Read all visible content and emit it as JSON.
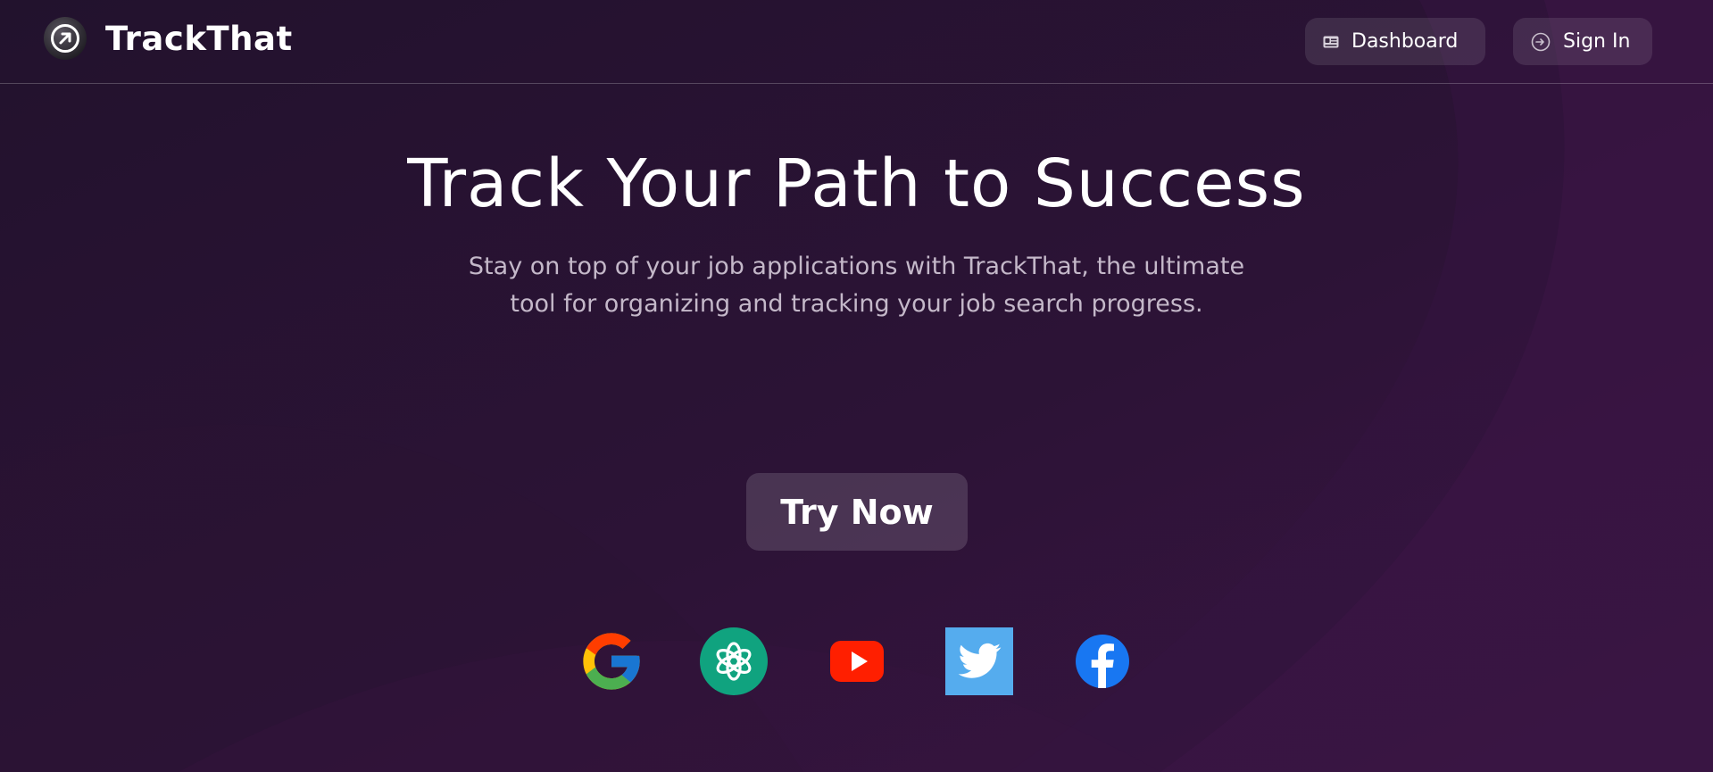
{
  "brand": {
    "name": "TrackThat",
    "logo_icon": "arrow-up-right-circle-icon"
  },
  "nav": {
    "dashboard_label": "Dashboard",
    "dashboard_icon": "id-card-icon",
    "signin_label": "Sign In",
    "signin_icon": "sign-in-icon"
  },
  "hero": {
    "title": "Track Your Path to Success",
    "subtitle": "Stay on top of your job applications with TrackThat, the ultimate tool for organizing and tracking your job search progress.",
    "cta_label": "Try Now"
  },
  "logos": [
    {
      "name": "google-icon"
    },
    {
      "name": "openai-icon"
    },
    {
      "name": "youtube-icon"
    },
    {
      "name": "twitter-icon"
    },
    {
      "name": "facebook-icon"
    }
  ],
  "colors": {
    "background_dark": "#261330",
    "background_accent": "#3b1442",
    "button_bg": "rgba(255,255,255,0.12)",
    "subtitle_text": "#c4b8c9",
    "openai_green": "#10a37f",
    "youtube_red": "#ff0000",
    "twitter_blue": "#55acee",
    "facebook_blue": "#1877f2"
  }
}
